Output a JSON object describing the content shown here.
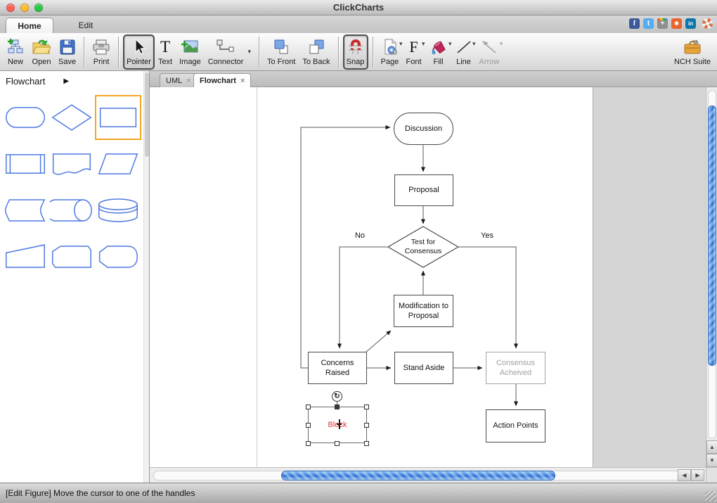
{
  "window": {
    "title": "ClickCharts"
  },
  "ribbon": {
    "tabs": [
      {
        "label": "Home"
      },
      {
        "label": "Edit"
      }
    ]
  },
  "social": {
    "facebook": "f",
    "twitter": "t",
    "googleplus": "+",
    "share": "✱",
    "linkedin": "in"
  },
  "toolbar": {
    "buttons": [
      {
        "label": "New"
      },
      {
        "label": "Open"
      },
      {
        "label": "Save"
      },
      {
        "label": "Print"
      },
      {
        "label": "Pointer",
        "selected": true
      },
      {
        "label": "Text"
      },
      {
        "label": "Image"
      },
      {
        "label": "Connector",
        "dropdown": true
      },
      {
        "label": "To Front"
      },
      {
        "label": "To Back"
      },
      {
        "label": "Snap",
        "selected": true
      },
      {
        "label": "Page",
        "dropdown": true
      },
      {
        "label": "Font",
        "dropdown": true
      },
      {
        "label": "Fill",
        "dropdown": true
      },
      {
        "label": "Line",
        "dropdown": true
      },
      {
        "label": "Arrow",
        "dropdown": true,
        "disabled": true
      },
      {
        "label": "NCH Suite"
      }
    ]
  },
  "icons": {
    "dropdown": "▾",
    "sidebar_arrow": "▶",
    "close": "×",
    "rotate": "↻",
    "up": "▲",
    "down": "▼",
    "left": "◀",
    "right": "▶"
  },
  "sidebar": {
    "title": "Flowchart",
    "shapes": [
      "terminator",
      "decision",
      "process",
      "predefined-process",
      "document",
      "data",
      "stored-data",
      "direct-access-storage",
      "database",
      "manual-input",
      "card",
      "display"
    ],
    "selected_index": 2
  },
  "doc_tabs": [
    {
      "label": "UML"
    },
    {
      "label": "Flowchart",
      "active": true
    }
  ],
  "canvas": {
    "nodes": [
      {
        "id": "discussion",
        "label": "Discussion",
        "shape": "terminator"
      },
      {
        "id": "proposal",
        "label": "Proposal",
        "shape": "process"
      },
      {
        "id": "test",
        "label": "Test for Consensus",
        "shape": "decision"
      },
      {
        "id": "modification",
        "label": "Modification to Proposal",
        "shape": "process"
      },
      {
        "id": "concerns",
        "label": "Concerns Raised",
        "shape": "process"
      },
      {
        "id": "stand",
        "label": "Stand Aside",
        "shape": "process"
      },
      {
        "id": "consensus",
        "label": "Consensus Acheived",
        "shape": "process",
        "dimmed": true
      },
      {
        "id": "action",
        "label": "Action Points",
        "shape": "process"
      },
      {
        "id": "block",
        "label": "Block",
        "shape": "process",
        "selected": true,
        "text_color": "#e03232"
      }
    ],
    "edge_labels": {
      "no": "No",
      "yes": "Yes"
    }
  },
  "statusbar": {
    "text": "[Edit Figure] Move the cursor to one of the handles"
  },
  "colors": {
    "palette_stroke": "#4f79e3",
    "palette_selected": "#f5a623",
    "scrollbar_thumb": "#3a82e0",
    "node_stroke": "#4a4a4a",
    "dimmed": "#a0a0a0",
    "block_text": "#e03232"
  }
}
